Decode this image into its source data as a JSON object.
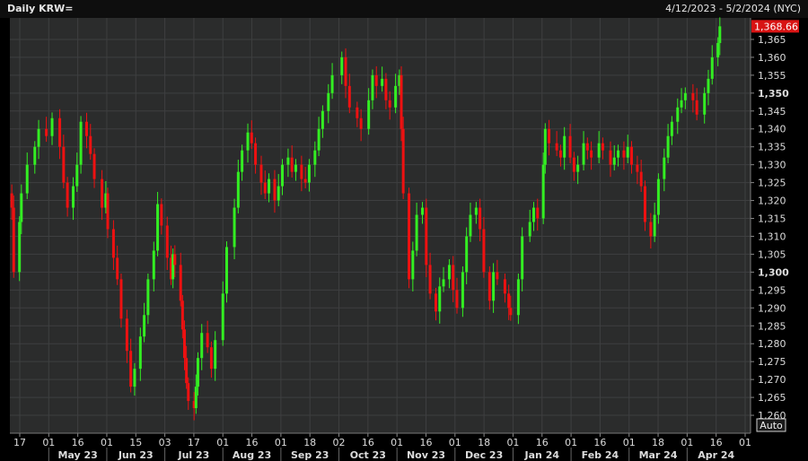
{
  "window": {
    "title": "Daily KRW=",
    "date_range": "4/12/2023 - 5/2/2024 (NYC)",
    "auto_label": "Auto"
  },
  "colors": {
    "background": "#000000",
    "plot_background": "#2b2c2c",
    "grid": "#3e3f40",
    "up": "#33ee22",
    "down": "#ee1111",
    "price_label_bg": "#d81414"
  },
  "chart_data": {
    "type": "candlestick",
    "title": "Daily KRW=",
    "y_axis_title": "Price",
    "ylim": [
      1255,
      1371
    ],
    "last_price": "1,368.66",
    "ytick_labels": [
      "1,365",
      "1,360",
      "1,355",
      "1,350",
      "1,345",
      "1,340",
      "1,335",
      "1,330",
      "1,325",
      "1,320",
      "1,315",
      "1,310",
      "1,305",
      "1,300",
      "1,295",
      "1,290",
      "1,285",
      "1,280",
      "1,275",
      "1,270",
      "1,265",
      "1,260"
    ],
    "bold_ticks": [
      "1,350",
      "1,300"
    ],
    "x_day_ticks": [
      "17",
      "01",
      "16",
      "01",
      "15",
      "03",
      "17",
      "01",
      "16",
      "01",
      "18",
      "02",
      "16",
      "01",
      "16",
      "01",
      "18",
      "01",
      "16",
      "01",
      "16",
      "01",
      "18",
      "01",
      "16",
      "01"
    ],
    "x_month_labels": [
      "May 23",
      "Jun 23",
      "Jul 23",
      "Aug 23",
      "Sep 23",
      "Oct 23",
      "Nov 23",
      "Dec 23",
      "Jan 24",
      "Feb 24",
      "Mar 24",
      "Apr 24"
    ],
    "close_path": [
      [
        "4/12/2023",
        1322
      ],
      [
        "4/13/2023",
        1318
      ],
      [
        "4/14/2023",
        1300
      ],
      [
        "4/17/2023",
        1314
      ],
      [
        "4/18/2023",
        1322
      ],
      [
        "4/21/2023",
        1330
      ],
      [
        "4/25/2023",
        1335
      ],
      [
        "4/27/2023",
        1340
      ],
      [
        "5/1/2023",
        1338
      ],
      [
        "5/4/2023",
        1343
      ],
      [
        "5/8/2023",
        1335
      ],
      [
        "5/10/2023",
        1325
      ],
      [
        "5/12/2023",
        1318
      ],
      [
        "5/15/2023",
        1324
      ],
      [
        "5/17/2023",
        1330
      ],
      [
        "5/19/2023",
        1342
      ],
      [
        "5/22/2023",
        1338
      ],
      [
        "5/24/2023",
        1333
      ],
      [
        "5/26/2023",
        1326
      ],
      [
        "5/30/2023",
        1318
      ],
      [
        "6/1/2023",
        1322
      ],
      [
        "6/2/2023",
        1312
      ],
      [
        "6/5/2023",
        1304
      ],
      [
        "6/7/2023",
        1298
      ],
      [
        "6/9/2023",
        1287
      ],
      [
        "6/12/2023",
        1278
      ],
      [
        "6/14/2023",
        1268
      ],
      [
        "6/16/2023",
        1273
      ],
      [
        "6/19/2023",
        1282
      ],
      [
        "6/21/2023",
        1288
      ],
      [
        "6/23/2023",
        1298
      ],
      [
        "6/26/2023",
        1306
      ],
      [
        "6/28/2023",
        1319
      ],
      [
        "6/30/2023",
        1313
      ],
      [
        "7/3/2023",
        1304
      ],
      [
        "7/5/2023",
        1298
      ],
      [
        "7/6/2023",
        1305
      ],
      [
        "7/7/2023",
        1302
      ],
      [
        "7/10/2023",
        1292
      ],
      [
        "7/11/2023",
        1284
      ],
      [
        "7/12/2023",
        1276
      ],
      [
        "7/13/2023",
        1269
      ],
      [
        "7/14/2023",
        1264
      ],
      [
        "7/17/2023",
        1262
      ],
      [
        "7/18/2023",
        1268
      ],
      [
        "7/19/2023",
        1276
      ],
      [
        "7/21/2023",
        1283
      ],
      [
        "7/24/2023",
        1279
      ],
      [
        "7/26/2023",
        1273
      ],
      [
        "7/28/2023",
        1281
      ],
      [
        "8/1/2023",
        1294
      ],
      [
        "8/3/2023",
        1307
      ],
      [
        "8/7/2023",
        1318
      ],
      [
        "8/9/2023",
        1328
      ],
      [
        "8/11/2023",
        1334
      ],
      [
        "8/14/2023",
        1339
      ],
      [
        "8/16/2023",
        1336
      ],
      [
        "8/18/2023",
        1330
      ],
      [
        "8/21/2023",
        1325
      ],
      [
        "8/23/2023",
        1322
      ],
      [
        "8/25/2023",
        1326
      ],
      [
        "8/28/2023",
        1320
      ],
      [
        "8/30/2023",
        1324
      ],
      [
        "9/1/2023",
        1330
      ],
      [
        "9/4/2023",
        1332
      ],
      [
        "9/6/2023",
        1328
      ],
      [
        "9/8/2023",
        1330
      ],
      [
        "9/11/2023",
        1326
      ],
      [
        "9/13/2023",
        1325
      ],
      [
        "9/15/2023",
        1330
      ],
      [
        "9/18/2023",
        1334
      ],
      [
        "9/20/2023",
        1340
      ],
      [
        "9/22/2023",
        1345
      ],
      [
        "9/25/2023",
        1350
      ],
      [
        "9/27/2023",
        1355
      ],
      [
        "10/2/2023",
        1360
      ],
      [
        "10/4/2023",
        1352
      ],
      [
        "10/6/2023",
        1346
      ],
      [
        "10/10/2023",
        1343
      ],
      [
        "10/12/2023",
        1340
      ],
      [
        "10/16/2023",
        1348
      ],
      [
        "10/18/2023",
        1355
      ],
      [
        "10/20/2023",
        1352
      ],
      [
        "10/23/2023",
        1354
      ],
      [
        "10/25/2023",
        1348
      ],
      [
        "10/27/2023",
        1346
      ],
      [
        "10/30/2023",
        1352
      ],
      [
        "11/1/2023",
        1355
      ],
      [
        "11/2/2023",
        1340
      ],
      [
        "11/3/2023",
        1322
      ],
      [
        "11/6/2023",
        1298
      ],
      [
        "11/8/2023",
        1306
      ],
      [
        "11/10/2023",
        1316
      ],
      [
        "11/13/2023",
        1318
      ],
      [
        "11/15/2023",
        1302
      ],
      [
        "11/17/2023",
        1294
      ],
      [
        "11/20/2023",
        1289
      ],
      [
        "11/22/2023",
        1296
      ],
      [
        "11/24/2023",
        1298
      ],
      [
        "11/27/2023",
        1302
      ],
      [
        "11/29/2023",
        1295
      ],
      [
        "12/1/2023",
        1290
      ],
      [
        "12/4/2023",
        1300
      ],
      [
        "12/6/2023",
        1310
      ],
      [
        "12/8/2023",
        1316
      ],
      [
        "12/11/2023",
        1318
      ],
      [
        "12/13/2023",
        1312
      ],
      [
        "12/15/2023",
        1300
      ],
      [
        "12/18/2023",
        1292
      ],
      [
        "12/20/2023",
        1300
      ],
      [
        "12/22/2023",
        1298
      ],
      [
        "12/26/2023",
        1294
      ],
      [
        "12/28/2023",
        1290
      ],
      [
        "12/29/2023",
        1288
      ],
      [
        "1/2/2024",
        1298
      ],
      [
        "1/4/2024",
        1310
      ],
      [
        "1/8/2024",
        1314
      ],
      [
        "1/10/2024",
        1318
      ],
      [
        "1/12/2024",
        1315
      ],
      [
        "1/15/2024",
        1330
      ],
      [
        "1/16/2024",
        1340
      ],
      [
        "1/18/2024",
        1336
      ],
      [
        "1/22/2024",
        1334
      ],
      [
        "1/24/2024",
        1332
      ],
      [
        "1/26/2024",
        1338
      ],
      [
        "1/29/2024",
        1332
      ],
      [
        "1/31/2024",
        1328
      ],
      [
        "2/2/2024",
        1330
      ],
      [
        "2/5/2024",
        1336
      ],
      [
        "2/7/2024",
        1334
      ],
      [
        "2/9/2024",
        1332
      ],
      [
        "2/13/2024",
        1336
      ],
      [
        "2/15/2024",
        1334
      ],
      [
        "2/19/2024",
        1330
      ],
      [
        "2/21/2024",
        1332
      ],
      [
        "2/23/2024",
        1334
      ],
      [
        "2/26/2024",
        1332
      ],
      [
        "2/28/2024",
        1335
      ],
      [
        "3/1/2024",
        1330
      ],
      [
        "3/4/2024",
        1328
      ],
      [
        "3/6/2024",
        1324
      ],
      [
        "3/8/2024",
        1314
      ],
      [
        "3/11/2024",
        1310
      ],
      [
        "3/13/2024",
        1316
      ],
      [
        "3/15/2024",
        1326
      ],
      [
        "3/18/2024",
        1332
      ],
      [
        "3/20/2024",
        1338
      ],
      [
        "3/22/2024",
        1342
      ],
      [
        "3/25/2024",
        1346
      ],
      [
        "3/27/2024",
        1348
      ],
      [
        "3/29/2024",
        1350
      ],
      [
        "4/2/2024",
        1348
      ],
      [
        "4/4/2024",
        1344
      ],
      [
        "4/8/2024",
        1350
      ],
      [
        "4/10/2024",
        1354
      ],
      [
        "4/12/2024",
        1360
      ],
      [
        "4/15/2024",
        1364
      ],
      [
        "4/16/2024",
        1368.66
      ]
    ]
  }
}
